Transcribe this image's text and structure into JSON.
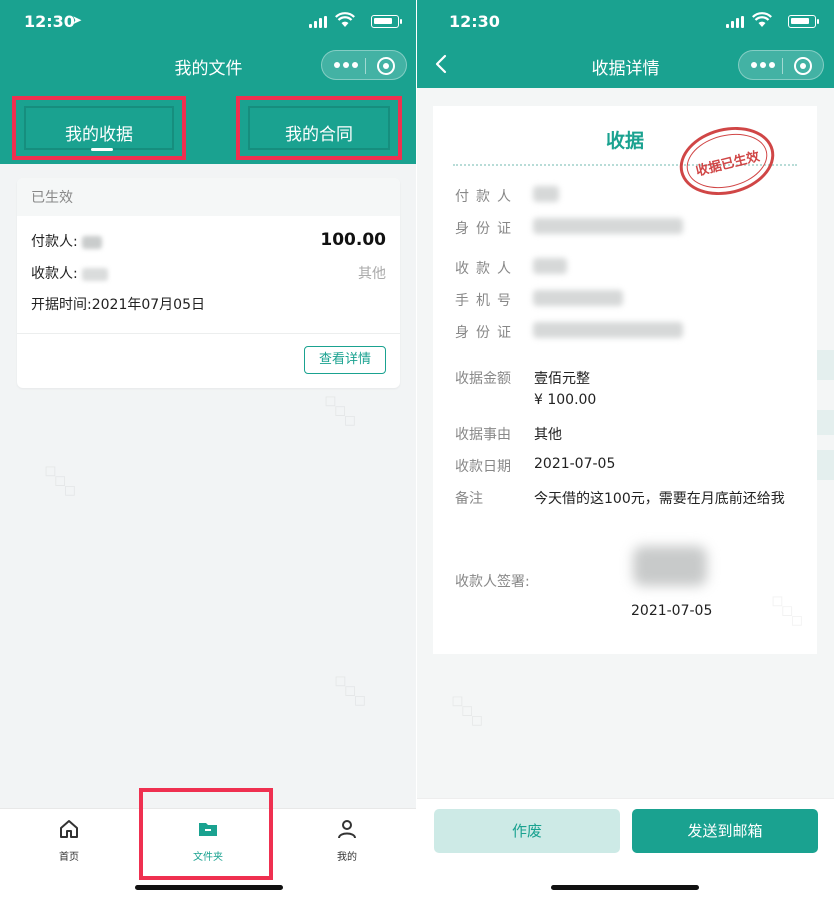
{
  "left": {
    "status": {
      "time": "12:30"
    },
    "nav": {
      "title": "我的文件"
    },
    "tabs": {
      "receipt": "我的收据",
      "contract": "我的合同"
    },
    "card": {
      "status": "已生效",
      "payer_label": "付款人:",
      "payee_label": "收款人:",
      "date_label": "开据时间:",
      "date_value": "2021年07月05日",
      "amount": "100.00",
      "category": "其他",
      "detail_button": "查看详情"
    },
    "tabbar": {
      "home": "首页",
      "folder": "文件夹",
      "mine": "我的"
    }
  },
  "right": {
    "status": {
      "time": "12:30"
    },
    "nav": {
      "title": "收据详情"
    },
    "receipt": {
      "title": "收据",
      "stamp": "收据已生效",
      "payer_label": "付款人",
      "id_label": "身份证",
      "payee_label": "收款人",
      "phone_label": "手机号",
      "id2_label": "身份证",
      "amount_label": "收据金额",
      "amount_words": "壹佰元整",
      "amount_value": "¥ 100.00",
      "reason_label": "收据事由",
      "reason_value": "其他",
      "date_label": "收款日期",
      "date_value": "2021-07-05",
      "note_label": "备注",
      "note_value": "今天借的这100元，需要在月底前还给我",
      "signature_label": "收款人签署:",
      "signature_date": "2021-07-05"
    },
    "footer": {
      "void_button": "作废",
      "send_button": "发送到邮箱"
    }
  },
  "colors": {
    "brand": "#1aa290",
    "highlight": "#ef3050",
    "stamp": "#cc3333"
  }
}
